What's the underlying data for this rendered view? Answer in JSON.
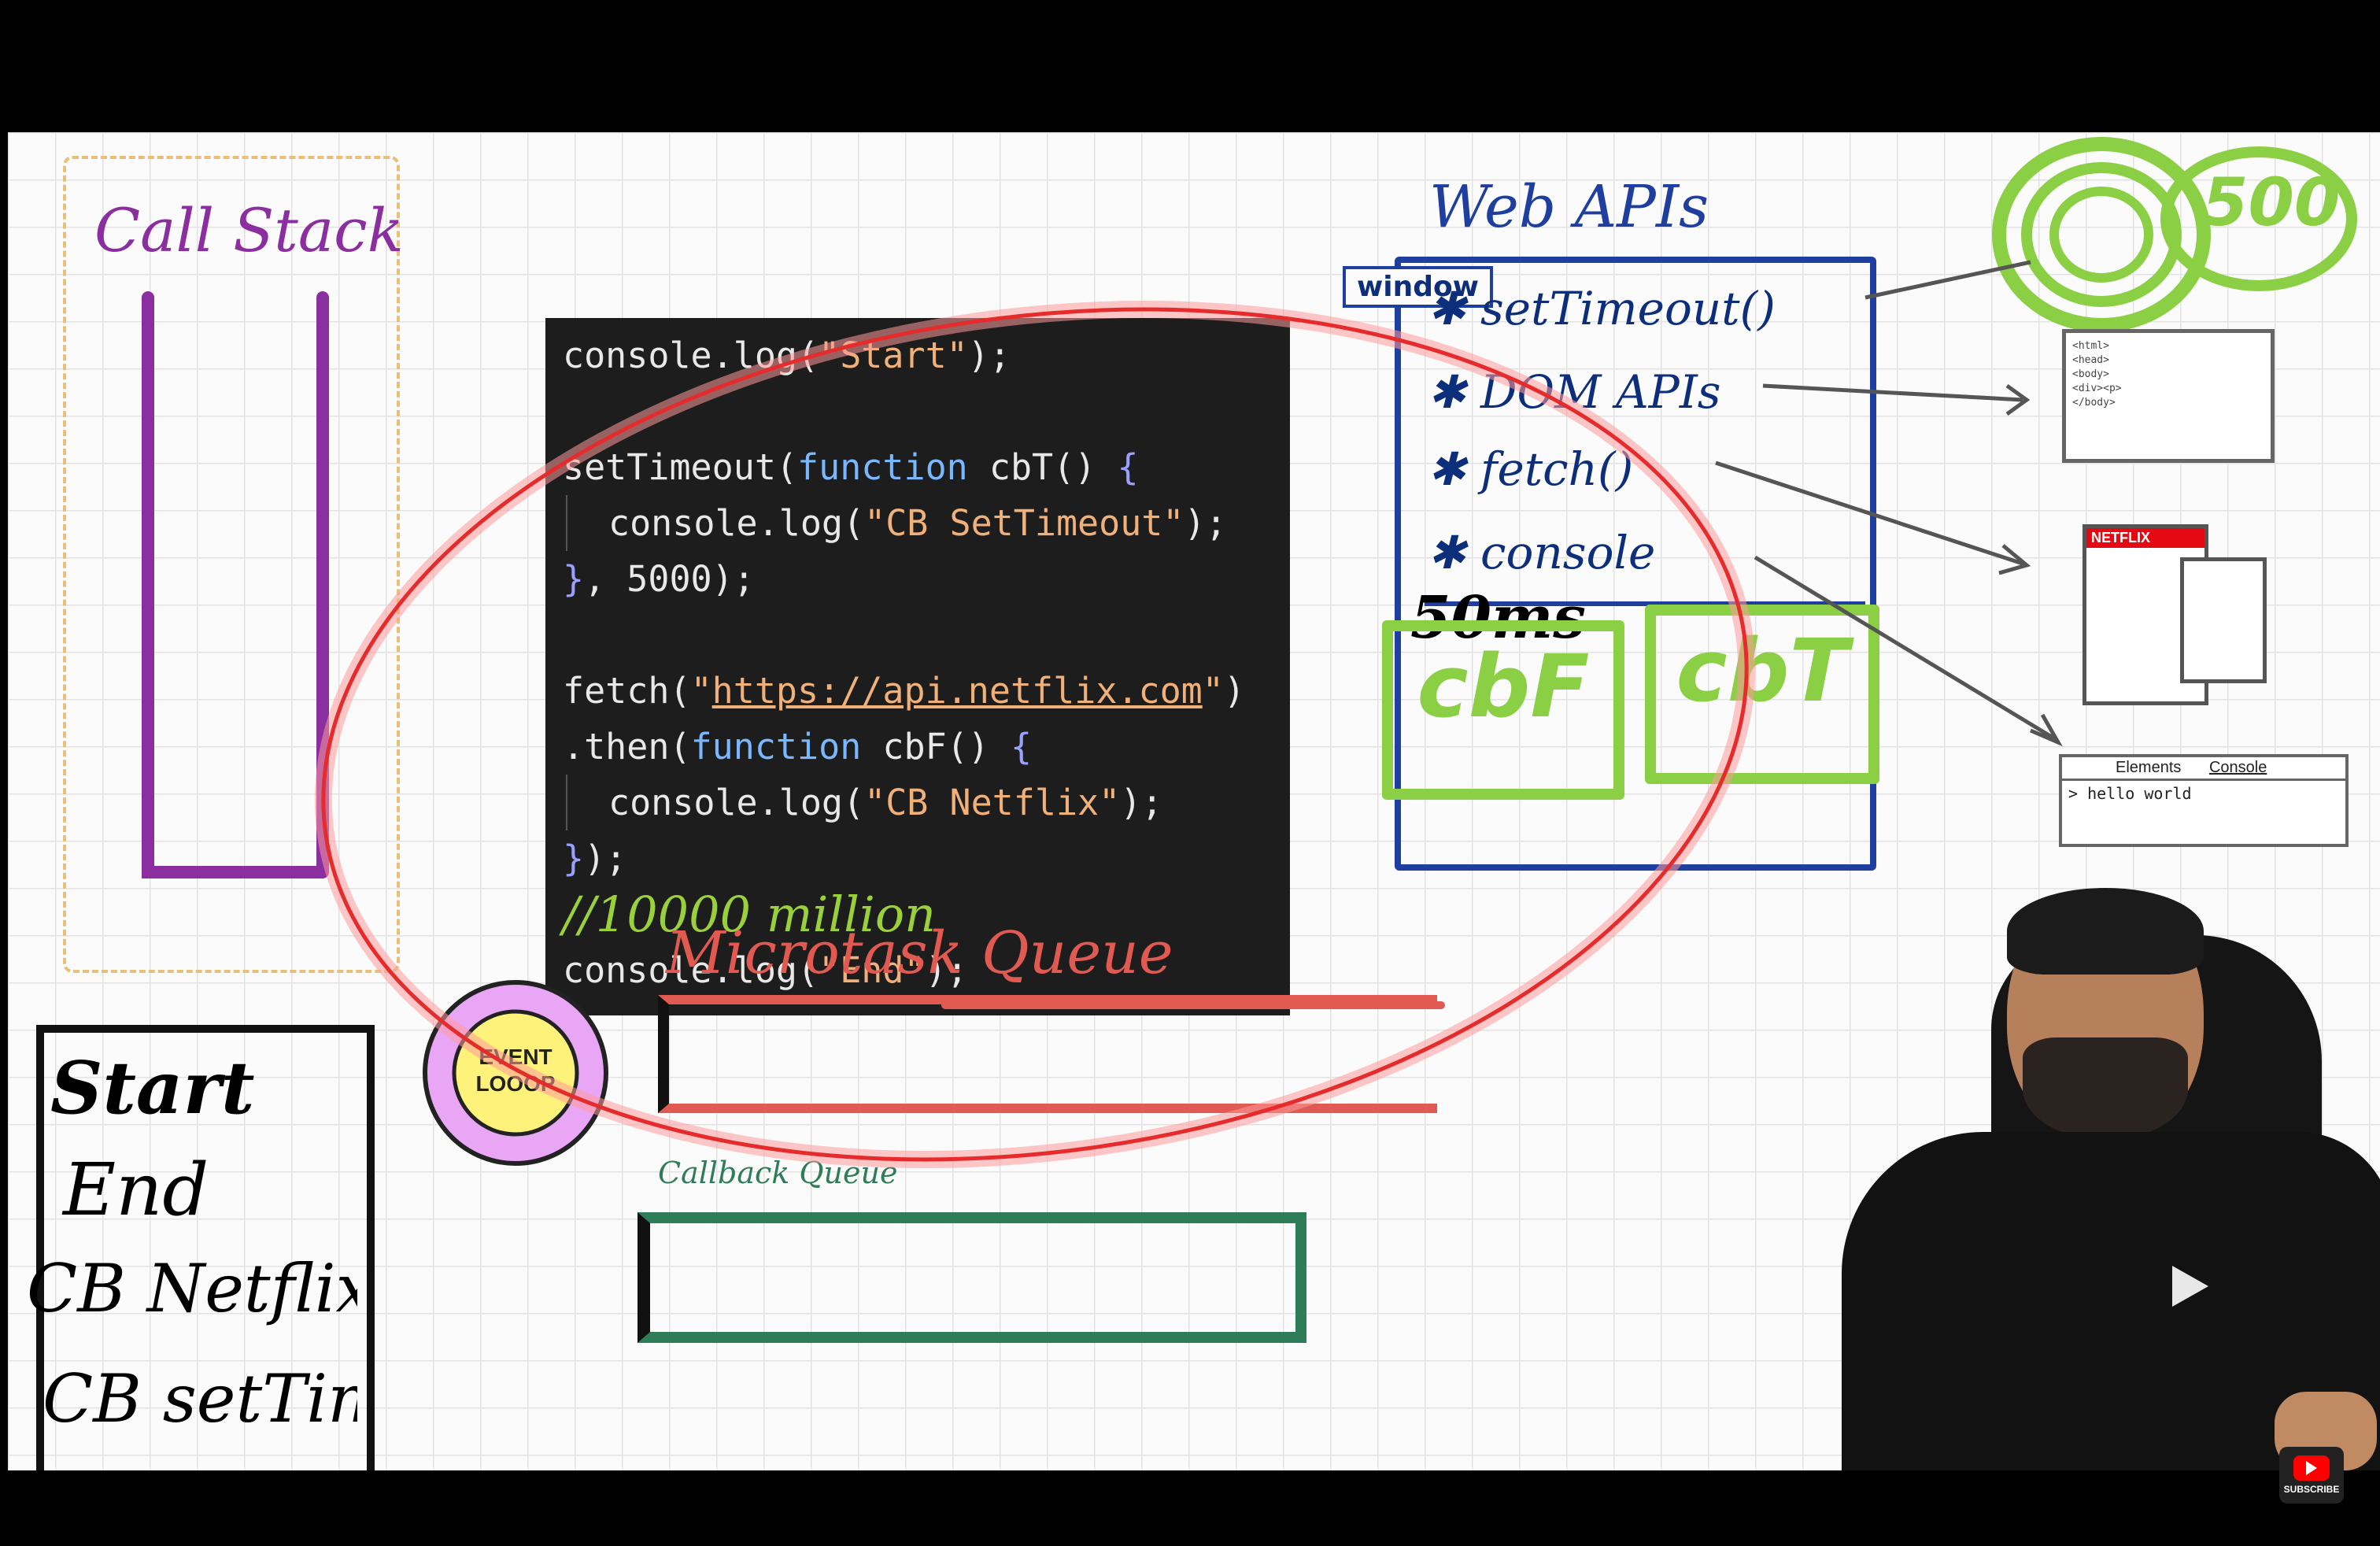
{
  "call_stack": {
    "title": "Call Stack"
  },
  "code": {
    "lines": [
      "console.log(\"Start\");",
      "",
      "setTimeout(function cbT() {",
      "  console.log(\"CB SetTimeout\");",
      "}, 5000);",
      "",
      "fetch(\"https://api.netflix.com\")",
      ".then(function cbF() {",
      "  console.log(\"CB Netflix\");",
      "});",
      "//10000 million",
      "console.log(\"End\");"
    ],
    "url": "https://api.netflix.com",
    "comment": "//10000 million"
  },
  "web_apis": {
    "title": "Web APIs",
    "window_label": "window",
    "items": [
      "setTimeout()",
      "DOM APIs",
      "fetch()",
      "console"
    ],
    "timer": "50ms",
    "callbacks": [
      "cbF",
      "cbT"
    ],
    "timer_badge": "500"
  },
  "console_panel": {
    "tabs": [
      "Elements",
      "Console"
    ],
    "output": "> hello world"
  },
  "netflix_logo": "NETFLIX",
  "event_loop": {
    "line1": "EVENT",
    "line2": "LOOOP"
  },
  "microtask_queue": {
    "title": "Microtask Queue"
  },
  "callback_queue": {
    "title": "Callback Queue"
  },
  "output": {
    "lines": [
      "Start",
      "End",
      "CB Netflix",
      "CB setTimeout"
    ]
  },
  "subscribe": {
    "label": "SUBSCRIBE"
  },
  "colors": {
    "call_stack": "#8a2ea0",
    "web_apis": "#1f3fa0",
    "microtask": "#e05a52",
    "callback": "#2f7d58",
    "green": "#8bcf45",
    "circle": "#e52b2b"
  }
}
